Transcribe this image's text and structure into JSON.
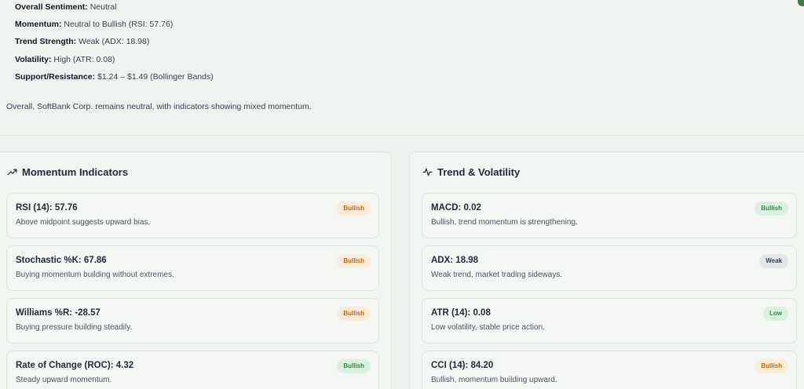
{
  "summary": {
    "sentiment": {
      "label": "Overall Sentiment:",
      "value": "Neutral"
    },
    "momentum": {
      "label": "Momentum:",
      "value": "Neutral to Bullish (RSI: 57.76)"
    },
    "trend_strength": {
      "label": "Trend Strength:",
      "value": "Weak (ADX: 18.98)"
    },
    "volatility": {
      "label": "Volatility:",
      "value": "High (ATR: 0.08)"
    },
    "support_resistance": {
      "label": "Support/Resistance:",
      "value": "$1.24 – $1.49 (Bollinger Bands)"
    },
    "overall_text": "Overall, SoftBank Corp. remains neutral, with indicators showing mixed momentum."
  },
  "momentum_panel": {
    "title": "Momentum Indicators",
    "icon": "trending-up-icon",
    "cards": [
      {
        "name": "RSI (14): 57.76",
        "desc": "Above midpoint suggests upward bias.",
        "badge": "Bullish",
        "badge_color": "#c2690f"
      },
      {
        "name": "Stochastic %K: 67.86",
        "desc": "Buying momentum building without extremes.",
        "badge": "Bullish",
        "badge_color": "#c2690f"
      },
      {
        "name": "Williams %R: -28.57",
        "desc": "Buying pressure building steadily.",
        "badge": "Bullish",
        "badge_color": "#c2690f"
      },
      {
        "name": "Rate of Change (ROC): 4.32",
        "desc": "Steady upward momentum.",
        "badge": "Bullish",
        "badge_color": "#2f8a47"
      }
    ]
  },
  "trend_panel": {
    "title": "Trend & Volatility",
    "icon": "activity-icon",
    "cards": [
      {
        "name": "MACD: 0.02",
        "desc": "Bullish, trend momentum is strengthening.",
        "badge": "Bullish",
        "badge_color": "#2f8a47"
      },
      {
        "name": "ADX: 18.98",
        "desc": "Weak trend, market trading sideways.",
        "badge": "Weak",
        "badge_color": "#374151"
      },
      {
        "name": "ATR (14): 0.08",
        "desc": "Low volatility, stable price action.",
        "badge": "Low",
        "badge_color": "#2f8a47"
      },
      {
        "name": "CCI (14): 84.20",
        "desc": "Bullish, momentum building upward.",
        "badge": "Bullish",
        "badge_color": "#c2690f"
      }
    ]
  }
}
